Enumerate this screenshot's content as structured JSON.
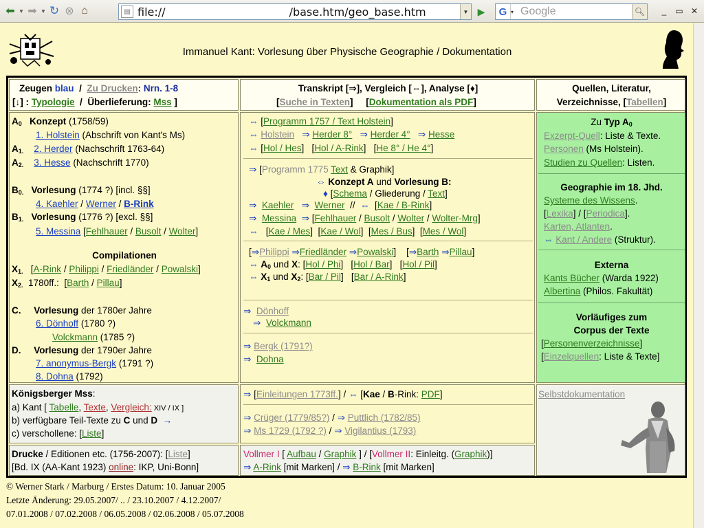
{
  "browser": {
    "url_scheme": "file://",
    "url_path": "/base.htm/geo_base.htm",
    "search_placeholder": "Google",
    "win_min": "_",
    "win_max": "▭",
    "win_close": "✕"
  },
  "header": {
    "title": "Immanuel Kant: Vorlesung über Physische Geographie / Dokumentation"
  },
  "left_header": {
    "zeugen": "Zeugen",
    "blau": "blau",
    "sep1": "/",
    "zu_drucken": "Zu Drucken",
    "nrn": ": Nrn. 1-8",
    "arrow_bracket": "[↓] :",
    "typologie": "Typologie",
    "sep2": "/",
    "ueberlieferung": "Überlieferung:",
    "mss": "Mss",
    "close": "]"
  },
  "mid_header": {
    "line1": "Transkript [⇒], Vergleich [⇔], Analyse [♦]",
    "suche": "Suche in Texten",
    "doku_pdf": "Dokumentation als PDF"
  },
  "right_header": {
    "line1": "Quellen, Literatur,",
    "line2_a": "Verzeichnisse, [",
    "tabellen": "Tabellen",
    "line2_b": "]"
  },
  "left_main": {
    "a0_label": "A",
    "a0_sub": "0",
    "a0_title": "Konzept",
    "a0_year": " (1758/59)",
    "holstein": "1. Holstein",
    "holstein_note": " (Abschrift von Kant's Ms)",
    "a1_label": "A",
    "a1_sub": "1.",
    "herder": "2. Herder",
    "herder_note": " (Nachschrift 1763-64)",
    "a2_label": "A",
    "a2_sub": "2.",
    "hesse": "3. Hesse",
    "hesse_note": " (Nachschrift 1770)",
    "b0_label": "B",
    "b0_sub": "0.",
    "b0_title": "Vorlesung",
    "b0_note": " (1774 ?) [incl. §§]",
    "kaehler": "4. Kaehler",
    "werner": "Werner",
    "b_rink": "B-Rink",
    "b1_label": "B",
    "b1_sub": "1.",
    "b1_title": "Vorlesung",
    "b1_note": " (1776 ?) [excl. §§]",
    "messina": "5. Messina",
    "fehlhauer": "Fehlhauer",
    "busolt": "Busolt",
    "wolter": "Wolter",
    "compilationen": "Compilationen",
    "x1_label": "X",
    "x1_sub": "1.",
    "a_rink": "A-Rink",
    "philippi": "Philippi",
    "friedlaender": "Friedländer",
    "powalski": "Powalski",
    "x2_label": "X",
    "x2_sub": "2.",
    "x2_note": "1780ff.:",
    "barth": "Barth",
    "pillau": "Pillau",
    "c_label": "C.",
    "c_title": "Vorlesung",
    "c_note": " der 1780er Jahre",
    "doenhoff": "6. Dönhoff",
    "doenhoff_note": " (1780 ?)",
    "volckmann": "Volckmann",
    "volckmann_note": " (1785 ?)",
    "d_label": "D.",
    "d_title": "Vorlesung",
    "d_note": " der 1790er Jahre",
    "bergk": "7. anonymus-Bergk",
    "bergk_note": " (1791 ?)",
    "dohna": "8. Dohna",
    "dohna_note": " (1792)"
  },
  "mid_main": {
    "prog1757": "Programm 1757 / Text Holstein",
    "holstein": "Holstein",
    "herder8": "Herder 8°",
    "herder4": "Herder 4°",
    "hesse": "Hesse",
    "hol_hes": "Hol / Hes",
    "hol_arink": "Hol / A-Rink",
    "he_8_4": "He  8° / He  4°",
    "prog1775": "Programm 1775",
    "text": "Text",
    "graphik_suffix": " & Graphik]",
    "konzept_line": "Konzept A",
    "und_vorlesung": " und ",
    "vorlesung_b": "Vorlesung B:",
    "schema": "Schema",
    "gliederung": " / Gliederung / ",
    "text2": "Text",
    "kaehler": "Kaehler",
    "werner": "Werner",
    "kae_brink": "Kae / B-Rink",
    "messina": "Messina",
    "fehlhauer": "Fehlhauer",
    "busolt": "Busolt",
    "wolter": "Wolter",
    "wolter_mrg": "Wolter-Mrg",
    "kae_mes": "Kae / Mes",
    "kae_wol": "Kae / Wol",
    "mes_bus": "Mes / Bus",
    "mes_wol": "Mes / Wol",
    "philippi": "Philippi",
    "friedlaender": "Friedländer",
    "powalski": "Powalski",
    "barth": "Barth",
    "pillau": "Pillau",
    "a0_und_x": " und ",
    "hol_phi": "Hol / Phi",
    "hol_bar": "Hol / Bar",
    "hol_pil": "Hol / Pil",
    "bar_pil": "Bar / Pil",
    "bar_arink": "Bar / A-Rink",
    "doenhoff": "Dönhoff",
    "volckmann": "Volckmann",
    "bergk": "Bergk (1791?)",
    "dohna": "Dohna"
  },
  "right_main": {
    "zu_typ": "Zu ",
    "typ": "Typ A",
    "typ_sub": "0",
    "exzerpt": "Exzerpt-Quell",
    "exzerpt_note": ": Liste & Texte.",
    "personen": "Personen",
    "personen_note": " (Ms Holstein).",
    "studien": "Studien zu Quellen",
    "studien_note": ": Listen.",
    "geo_title": "Geographie im 18. Jhd.",
    "systeme": "Systeme des Wissens",
    "lexika": "Lexika",
    "periodica": "Periodica",
    "karten": "Karten, Atlanten",
    "kant_andere": "Kant / Andere",
    "struktur": " (Struktur).",
    "externa": "Externa",
    "kants_buecher": "Kants Bücher",
    "warda": " (Warda 1922)",
    "albertina": "Albertina",
    "philos": " (Philos. Fakultät)",
    "vorl_1": "Vorläufiges zum",
    "vorl_2": "Corpus der Texte",
    "personenverz": "Personenverzeichnisse",
    "einzelquellen": "Einzelquellen",
    "einzel_note": ": Liste & Texte]"
  },
  "koenigsberg": {
    "title": "Königsberger Mss",
    "colon": ":",
    "a_prefix": "a) Kant [ ",
    "tabelle": "Tabelle",
    "texte": "Texte",
    "vergleich": "Vergleich:",
    "roman": " XIV / IX ]",
    "b_line": "b) verfügbare Teil-Texte zu ",
    "b_c": "C",
    "b_und": " und ",
    "b_d": "D",
    "c_line": "c) verschollene: [",
    "liste": "Liste",
    "c_close": "]"
  },
  "mid_lower": {
    "einleitungen": "Einleitungen 1773ff.",
    "kae_brink_pdf_a": "Kae",
    "kae_brink_pdf_b": " / ",
    "kae_brink_pdf_c": "B",
    "kae_brink_pdf_d": "-Rink: ",
    "pdf": "PDF",
    "krueger": "Crüger (1779/85?)",
    "puttlich": "Puttlich (1782/85)",
    "ms1729": "Ms 1729 (1792 ?)",
    "vigilantius": "Vigilantius (1793)"
  },
  "selbst": {
    "label": "Selbstdokumentation"
  },
  "drucke": {
    "title": "Drucke",
    "note": " / Editionen etc. (1756-2007): [",
    "liste": "Liste",
    "close": "]",
    "bd": "[Bd. IX (AA-Kant 1923) ",
    "online": "online",
    "ikp": ": IKP, Uni-Bonn]"
  },
  "vollmer": {
    "v1": "Vollmer I",
    "aufbau": "Aufbau",
    "graphik": "Graphik",
    "v2": "Vollmer II",
    "einleitg": ": Einleitg. (",
    "graphik2": "Graphik",
    "close": ")]",
    "arink": "A-Rink",
    "marken1": " [mit Marken]  /  ",
    "brink": "B-Rink",
    "marken2": " [mit Marken]"
  },
  "footer": {
    "line1": "© Werner Stark / Marburg / Erstes Datum: 10. Januar 2005",
    "line2": "Letzte Änderung: 29.05.2007/ .. / 23.10.2007 / 4.12.2007/",
    "line3": "07.01.2008 / 07.02.2008 / 06.05.2008 / 02.06.2008 / 05.07.2008"
  }
}
